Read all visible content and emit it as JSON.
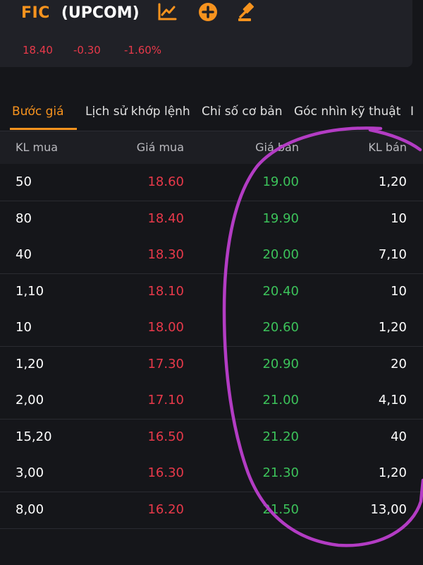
{
  "header": {
    "ticker": "FIC",
    "exchange": "(UPCOM)",
    "price": "18.40",
    "change": "-0.30",
    "change_pct": "-1.60%",
    "icons": [
      "chart-line-icon",
      "plus-circle-icon",
      "auction-hammer-icon"
    ],
    "accent_color": "#f7931e",
    "down_color": "#e8394a",
    "up_color": "#3cc25a"
  },
  "tabs": [
    {
      "label": "Bước giá",
      "active": true
    },
    {
      "label": "Lịch sử khớp lệnh",
      "active": false
    },
    {
      "label": "Chỉ số cơ bản",
      "active": false
    },
    {
      "label": "Góc nhìn kỹ thuật",
      "active": false
    },
    {
      "label": "I",
      "active": false
    }
  ],
  "table": {
    "columns": [
      "KL mua",
      "Giá mua",
      "Giá bán",
      "KL bán"
    ],
    "rows": [
      [
        "50",
        "18.60",
        "19.00",
        "1,20"
      ],
      [
        "80",
        "18.40",
        "19.90",
        "10"
      ],
      [
        "40",
        "18.30",
        "20.00",
        "7,10"
      ],
      [
        "1,10",
        "18.10",
        "20.40",
        "10"
      ],
      [
        "10",
        "18.00",
        "20.60",
        "1,20"
      ],
      [
        "1,20",
        "17.30",
        "20.90",
        "20"
      ],
      [
        "2,00",
        "17.10",
        "21.00",
        "4,10"
      ],
      [
        "15,20",
        "16.50",
        "21.20",
        "40"
      ],
      [
        "3,00",
        "16.30",
        "21.30",
        "1,20"
      ],
      [
        "8,00",
        "16.20",
        "21.50",
        "13,00"
      ]
    ]
  },
  "annotation": {
    "color": "#b33cc4"
  }
}
